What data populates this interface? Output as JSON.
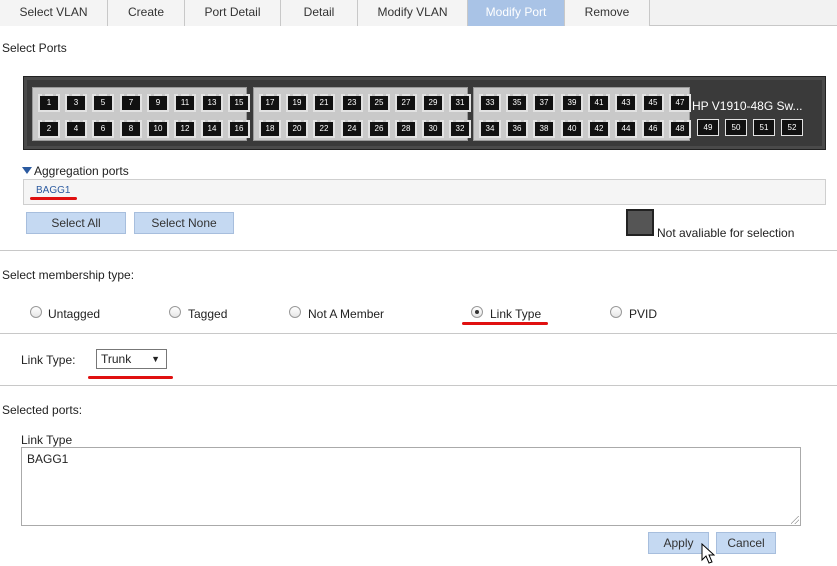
{
  "tabs": [
    {
      "label": "Select VLAN",
      "active": false
    },
    {
      "label": "Create",
      "active": false
    },
    {
      "label": "Port Detail",
      "active": false
    },
    {
      "label": "Detail",
      "active": false
    },
    {
      "label": "Modify VLAN",
      "active": false
    },
    {
      "label": "Modify Port",
      "active": true
    },
    {
      "label": "Remove",
      "active": false
    }
  ],
  "select_ports": {
    "title": "Select Ports",
    "device_name": "HP V1910-48G Sw...",
    "ports_top": [
      "1",
      "3",
      "5",
      "7",
      "9",
      "11",
      "13",
      "15",
      "17",
      "19",
      "21",
      "23",
      "25",
      "27",
      "29",
      "31",
      "33",
      "35",
      "37",
      "39",
      "41",
      "43",
      "45",
      "47"
    ],
    "ports_bottom": [
      "2",
      "4",
      "6",
      "8",
      "10",
      "12",
      "14",
      "16",
      "18",
      "20",
      "22",
      "24",
      "26",
      "28",
      "30",
      "32",
      "34",
      "36",
      "38",
      "40",
      "42",
      "44",
      "46",
      "48"
    ],
    "sfp_ports": [
      "49",
      "50",
      "51",
      "52"
    ]
  },
  "aggregation": {
    "title": "Aggregation ports",
    "items": [
      "BAGG1"
    ]
  },
  "buttons": {
    "select_all": "Select All",
    "select_none": "Select None",
    "apply": "Apply",
    "cancel": "Cancel"
  },
  "legend": {
    "not_available": "Not avaliable for selection"
  },
  "membership": {
    "title": "Select membership type:",
    "options": [
      {
        "label": "Untagged",
        "checked": false
      },
      {
        "label": "Tagged",
        "checked": false
      },
      {
        "label": "Not A Member",
        "checked": false
      },
      {
        "label": "Link Type",
        "checked": true
      },
      {
        "label": "PVID",
        "checked": false
      }
    ]
  },
  "link_type": {
    "label": "Link Type:",
    "value": "Trunk"
  },
  "selected_ports": {
    "title": "Selected ports:",
    "field_label": "Link Type",
    "value": "BAGG1"
  },
  "colors": {
    "tab_active": "#a9c3e6",
    "button": "#c5d9f2",
    "annotation_red": "#e01010",
    "panel_dark": "#3a3a3a"
  }
}
